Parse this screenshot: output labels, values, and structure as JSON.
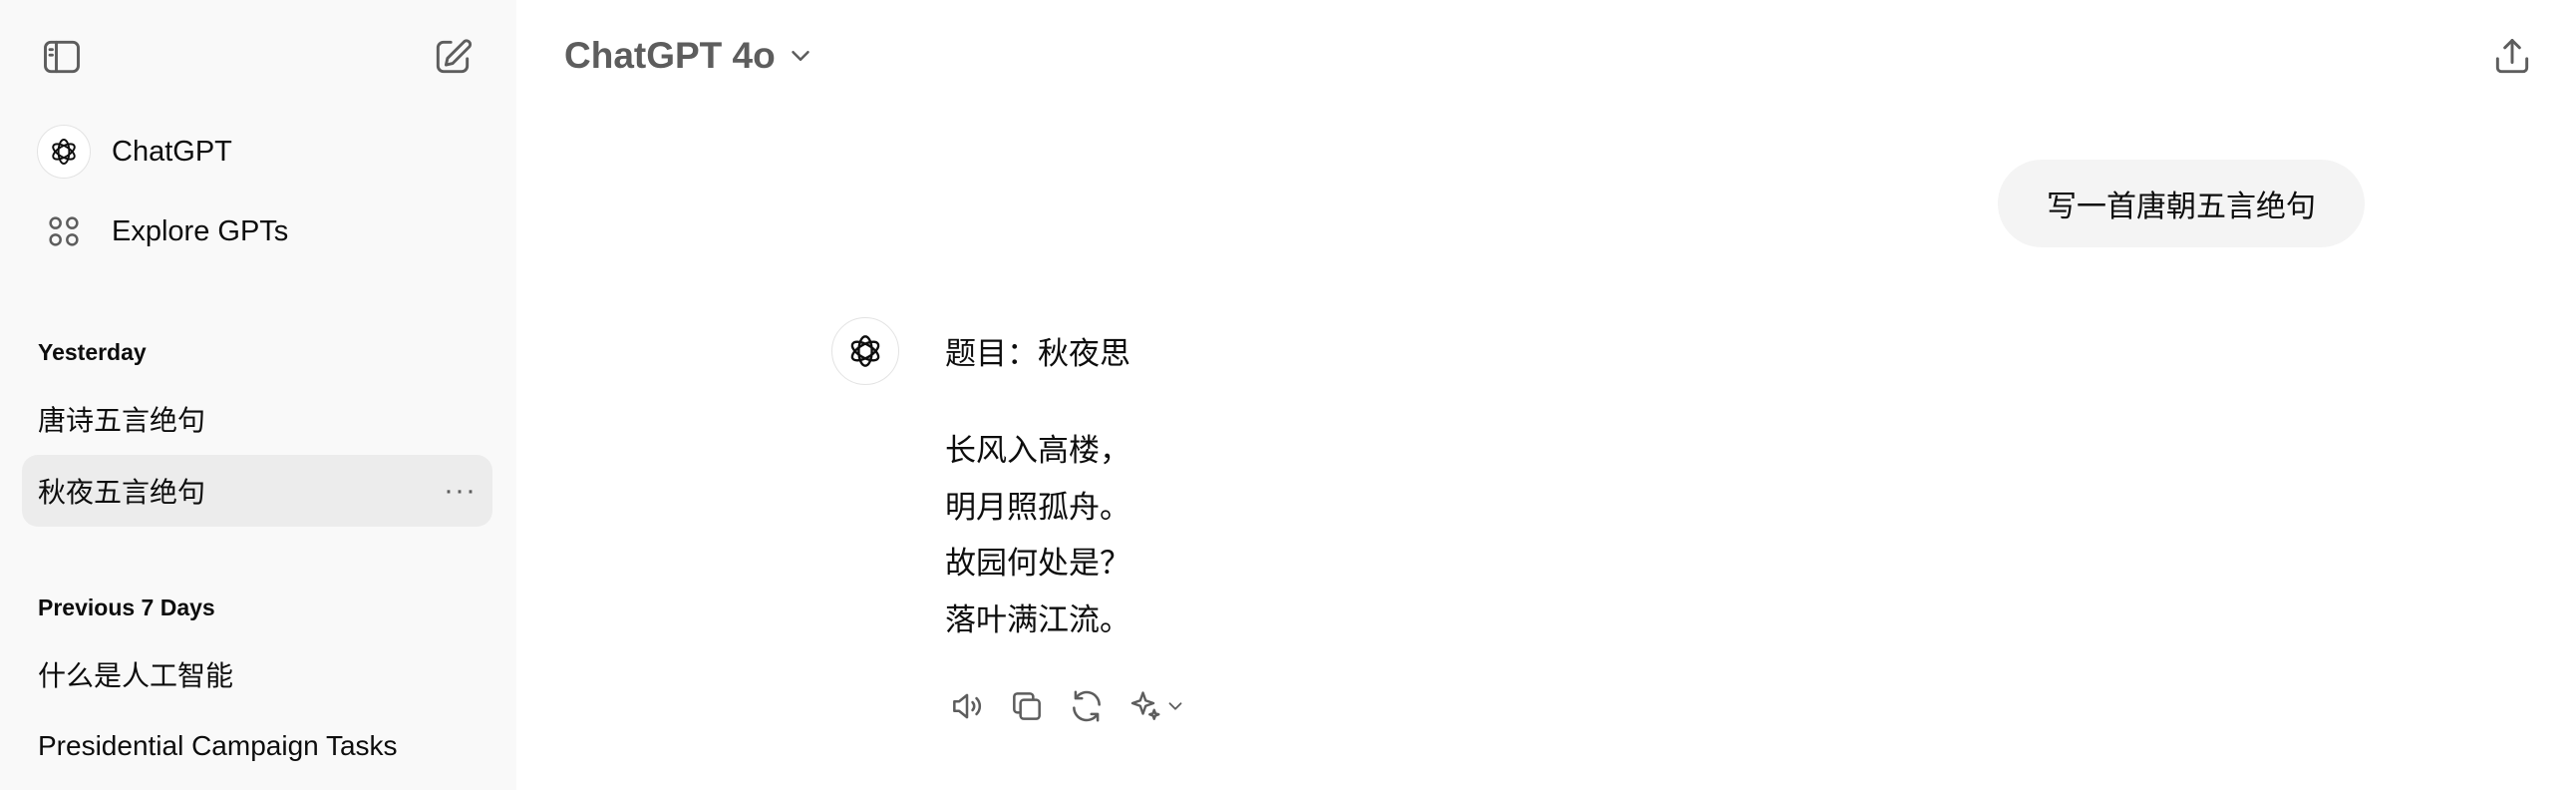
{
  "sidebar": {
    "nav": [
      {
        "label": "ChatGPT",
        "icon": "openai-logo-icon"
      },
      {
        "label": "Explore GPTs",
        "icon": "grid-dots-icon"
      }
    ],
    "sections": [
      {
        "title": "Yesterday",
        "items": [
          "唐诗五言绝句",
          "秋夜五言绝句"
        ]
      },
      {
        "title": "Previous 7 Days",
        "items": [
          "什么是人工智能",
          "Presidential Campaign Tasks"
        ]
      }
    ],
    "more_label": "···"
  },
  "header": {
    "model": "ChatGPT 4o"
  },
  "conversation": {
    "user_message": "写一首唐朝五言绝句",
    "assistant": {
      "title": "题目：秋夜思",
      "lines": [
        "长风入高楼，",
        "明月照孤舟。",
        "故园何处是？",
        "落叶满江流。"
      ]
    }
  },
  "colors": {
    "sidebar_bg": "#f9f9f9",
    "selected_item_bg": "#ececec",
    "user_bubble_bg": "#f4f4f4",
    "muted_text": "#5d5d5d"
  }
}
